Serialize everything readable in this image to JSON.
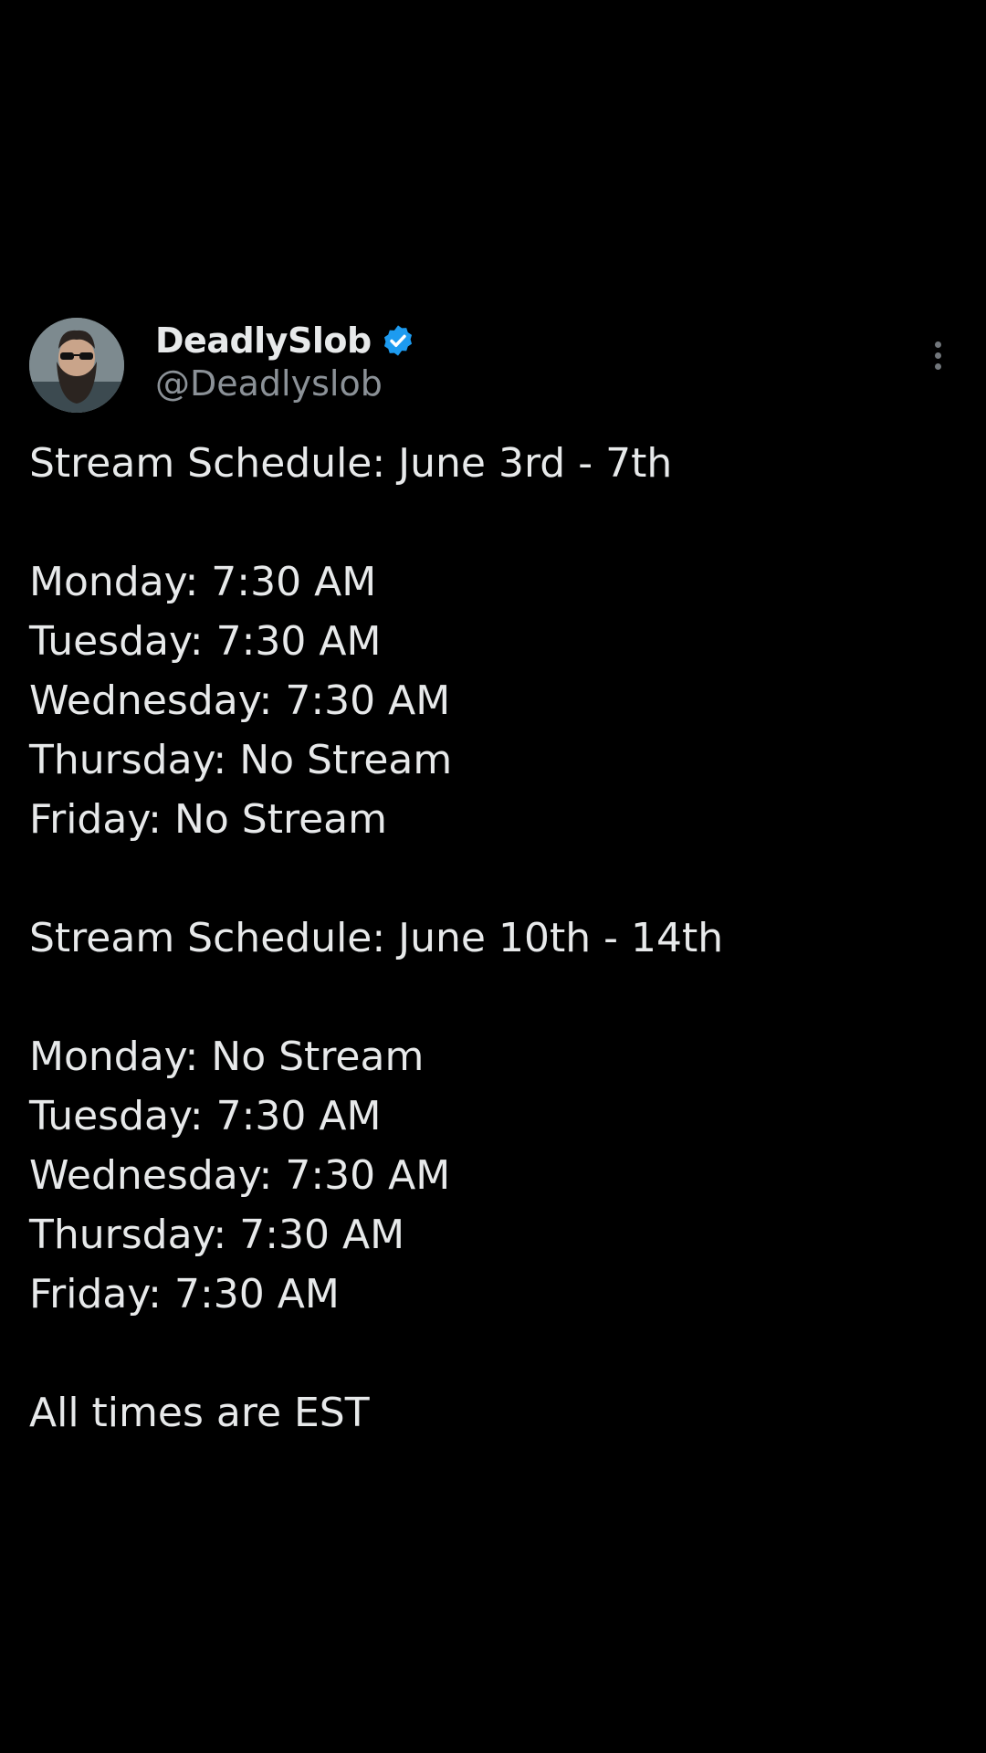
{
  "post": {
    "author": {
      "display_name": "DeadlySlob",
      "handle": "@Deadlyslob",
      "verified": true,
      "avatar_icon": "avatar-icon"
    },
    "more_icon": "more-options-icon",
    "colors": {
      "background": "#000000",
      "text": "#e7e9ea",
      "secondary_text": "#8b9197",
      "verified_badge": "#1d9bf0"
    },
    "text": {
      "schedule1_title": "Stream Schedule: June 3rd - 7th",
      "schedule1": [
        "Monday: 7:30 AM",
        "Tuesday: 7:30 AM",
        "Wednesday: 7:30 AM",
        "Thursday: No Stream",
        "Friday: No Stream"
      ],
      "schedule2_title": "Stream Schedule: June 10th - 14th",
      "schedule2": [
        "Monday: No Stream",
        "Tuesday: 7:30 AM",
        "Wednesday: 7:30 AM",
        "Thursday: 7:30 AM",
        "Friday: 7:30 AM"
      ],
      "footer": "All times are EST"
    }
  }
}
